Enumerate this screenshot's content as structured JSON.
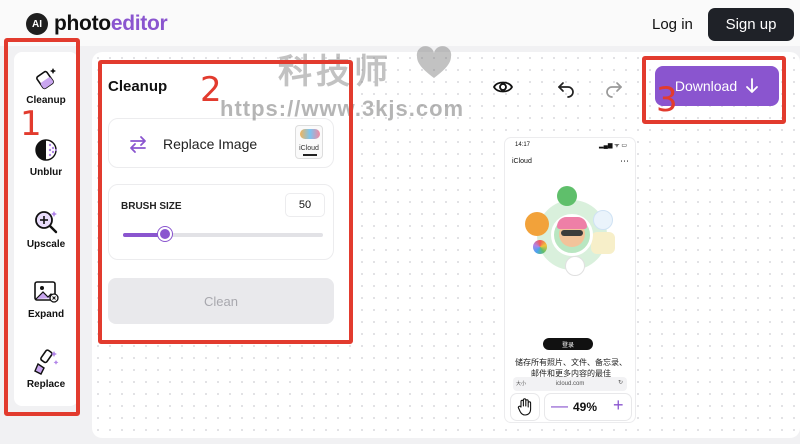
{
  "app": {
    "logo_badge": "AI",
    "logo_main": "photo",
    "logo_accent": "editor"
  },
  "header": {
    "login_label": "Log in",
    "signup_label": "Sign up"
  },
  "watermark": {
    "cn_text": "科技师",
    "url": "https://www.3kjs.com"
  },
  "tools": [
    {
      "label": "Cleanup",
      "icon": "eraser-sparkle-icon"
    },
    {
      "label": "Unblur",
      "icon": "unblur-icon"
    },
    {
      "label": "Upscale",
      "icon": "magnifier-plus-icon"
    },
    {
      "label": "Expand",
      "icon": "expand-image-icon"
    },
    {
      "label": "Replace",
      "icon": "brush-sparkle-icon"
    }
  ],
  "panel": {
    "title": "Cleanup",
    "replace_label": "Replace Image",
    "thumb_caption": "iCloud",
    "brush_label": "BRUSH SIZE",
    "brush_value": "50",
    "brush_fraction": 0.21,
    "clean_label": "Clean"
  },
  "toolbar": {
    "download_label": "Download"
  },
  "preview": {
    "status_time": "14:17",
    "status_right": "▂▄▆ ᯤ ▭",
    "app_name": "iCloud",
    "login_label": "登录",
    "body_text": "储存所有照片、文件、备忘录、邮件和更多内容的最佳",
    "url_left": "大小",
    "url": "icloud.com",
    "zoom": "49%"
  },
  "annotations": {
    "n1": "1",
    "n2": "2",
    "n3": "3"
  },
  "colors": {
    "accent": "#8a55cf",
    "annotation": "#e23b2e"
  }
}
